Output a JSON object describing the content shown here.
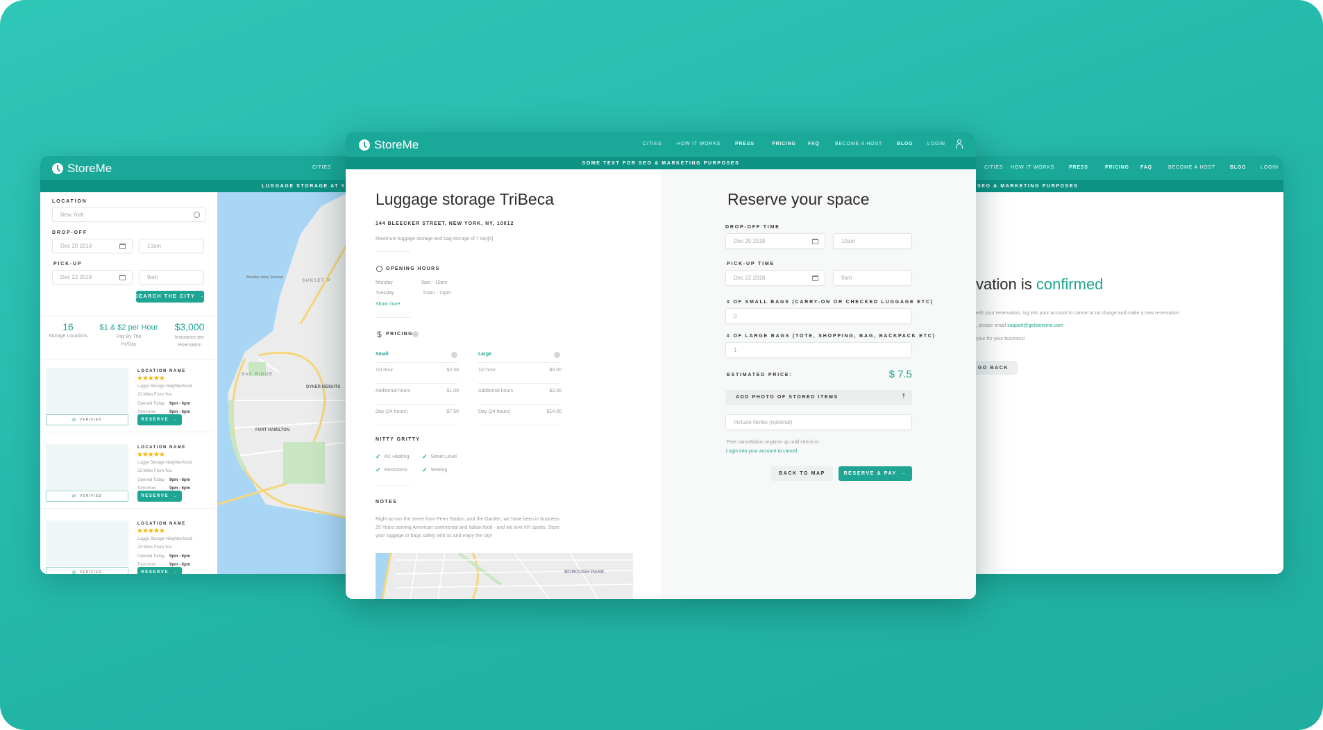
{
  "brand": "StoreMe",
  "colors": {
    "accent": "#1fa593",
    "nav": "#1aa898",
    "bar": "#0d9284"
  },
  "nav_items": [
    "CITIES",
    "HOW IT WORKS",
    "PRESS",
    "PRICING",
    "FAQ",
    "BECOME A HOST",
    "BLOG",
    "LOGIN"
  ],
  "search_card": {
    "nav_visible": "CITIES",
    "bar_text": "LUGGAGE STORAGE AT YOUR",
    "location_label": "LOCATION",
    "location_value": "New York",
    "dropoff_label": "DROP-OFF",
    "dropoff_date": "Dec 20 2018",
    "dropoff_time": "10am",
    "pickup_label": "PICK-UP",
    "pickup_date": "Dec 22 2018",
    "pickup_time": "9am",
    "search_button": "SEARCH THE CITY",
    "stats": [
      {
        "value": "16",
        "caption": "Storage Locations"
      },
      {
        "value": "$1 & $2 per Hour",
        "caption": "Pay By The Hr/Day"
      },
      {
        "value": "$3,000",
        "caption": "Insurance per reservation"
      }
    ],
    "listings": [
      {
        "name": "LOCATION NAME",
        "rating": 5,
        "stars": "★★★★★",
        "neighborhood": "Lugge Storage Neighborhood",
        "distance": "23 Miles From You",
        "today_label": "Opened Today",
        "today_hours": "9pm - 6pm",
        "tomorrow_label": "Tomorrow",
        "tomorrow_hours": "9pm - 6pm",
        "verified": "VERIFIED",
        "reserve": "RESERVE"
      },
      {
        "name": "LOCATION NAME",
        "rating": 5,
        "stars": "★★★★★",
        "neighborhood": "Lugge Storage Neighborhood",
        "distance": "23 Miles From You",
        "today_label": "Opened Today",
        "today_hours": "9pm - 6pm",
        "tomorrow_label": "Tomorrow",
        "tomorrow_hours": "9pm - 6pm",
        "verified": "VERIFIED",
        "reserve": "RESERVE"
      },
      {
        "name": "LOCATION NAME",
        "rating": 5,
        "stars": "★★★★★",
        "neighborhood": "Lugge Storage Neighborhood",
        "distance": "23 Miles From You",
        "today_label": "Opened Today",
        "today_hours": "9pm - 6pm",
        "tomorrow_label": "Tomorrow",
        "tomorrow_hours": "9pm - 6pm",
        "verified": "VERIFIED",
        "reserve": "RESERVE"
      }
    ],
    "map_labels": [
      "Brooklyn Army Terminal",
      "SUNSET P",
      "BAY RIDGE",
      "DYKER HEIGHTS",
      "FORT HAMILTON"
    ]
  },
  "detail_card": {
    "bar_text": "SOME TEXT FOR SEO & MARKETING PURPOSES",
    "title": "Luggage storage TriBeca",
    "address": "144 BLEECKER STREET, NEW YORK, NY, 10012",
    "description": "Maximum luggage storage and bag storage of 7 day[s]",
    "opening_hours_title": "OPENING HOURS",
    "hours": [
      {
        "day": "Monday",
        "time": "9am - 10pm"
      },
      {
        "day": "Tuesday",
        "time": "10am - 11pm"
      }
    ],
    "show_more": "Show more",
    "pricing_title": "PRICING",
    "pricing": [
      {
        "size": "Small",
        "rows": [
          {
            "label": "1st hour",
            "price": "$2.00"
          },
          {
            "label": "Additional hours",
            "price": "$1.00"
          },
          {
            "label": "Day (24 hours)",
            "price": "$7.50"
          }
        ]
      },
      {
        "size": "Large",
        "rows": [
          {
            "label": "1st hour",
            "price": "$3.00"
          },
          {
            "label": "Additional hours",
            "price": "$2.00"
          },
          {
            "label": "Day (24 hours)",
            "price": "$14.00"
          }
        ]
      }
    ],
    "nitty_title": "NITTY GRITTY",
    "amenities": [
      "AC Heating",
      "Street Level",
      "Restrooms",
      "Seating"
    ],
    "notes_title": "NOTES",
    "notes": "Right across the street from Penn Station, and the Garden, we have been in business 25 Years serving American continental and Italian food - and we love NY sports. Store your luggage or bags safely with us and enjoy the city!",
    "map_label": "BOROUGH PARK",
    "reserve": {
      "title": "Reserve your space",
      "dropoff_label": "DROP-OFF TIME",
      "dropoff_date": "Dec 20 2018",
      "dropoff_time": "10am",
      "pickup_label": "PICK-UP TIME",
      "pickup_date": "Dec 22 2018",
      "pickup_time": "9am",
      "small_label": "# OF SMALL BAGS (CARRY-ON OR CHECKED LUGGAGE ETC)",
      "small_value": "0",
      "large_label": "# OF LARGE BAGS (TOTE, SHOPPING, BAG, BACKPACK ETC)",
      "large_value": "1",
      "price_label": "ESTIMATED PRICE:",
      "price_value": "$ 7.5",
      "photo_button": "ADD PHOTO OF STORED ITEMS",
      "notes_placeholder": "Include Notes (optional)",
      "cancel_text": "Free cancellation anytime up until check-in.",
      "login_link": "Login into your account to cancel.",
      "back_button": "BACK TO MAP",
      "pay_button": "RESERVE & PAY"
    }
  },
  "confirm_card": {
    "bar_text": "SEO & MARKETING PURPOSES",
    "title_dark": "vation is ",
    "title_accent": "confirmed",
    "line1": "edit your reservation, log into your account to cancel at no charge and make a new reservation.",
    "line2": ", please email ",
    "email": "support@getstoreme.com",
    "line3": "your for your business!",
    "go_back": "GO BACK"
  }
}
